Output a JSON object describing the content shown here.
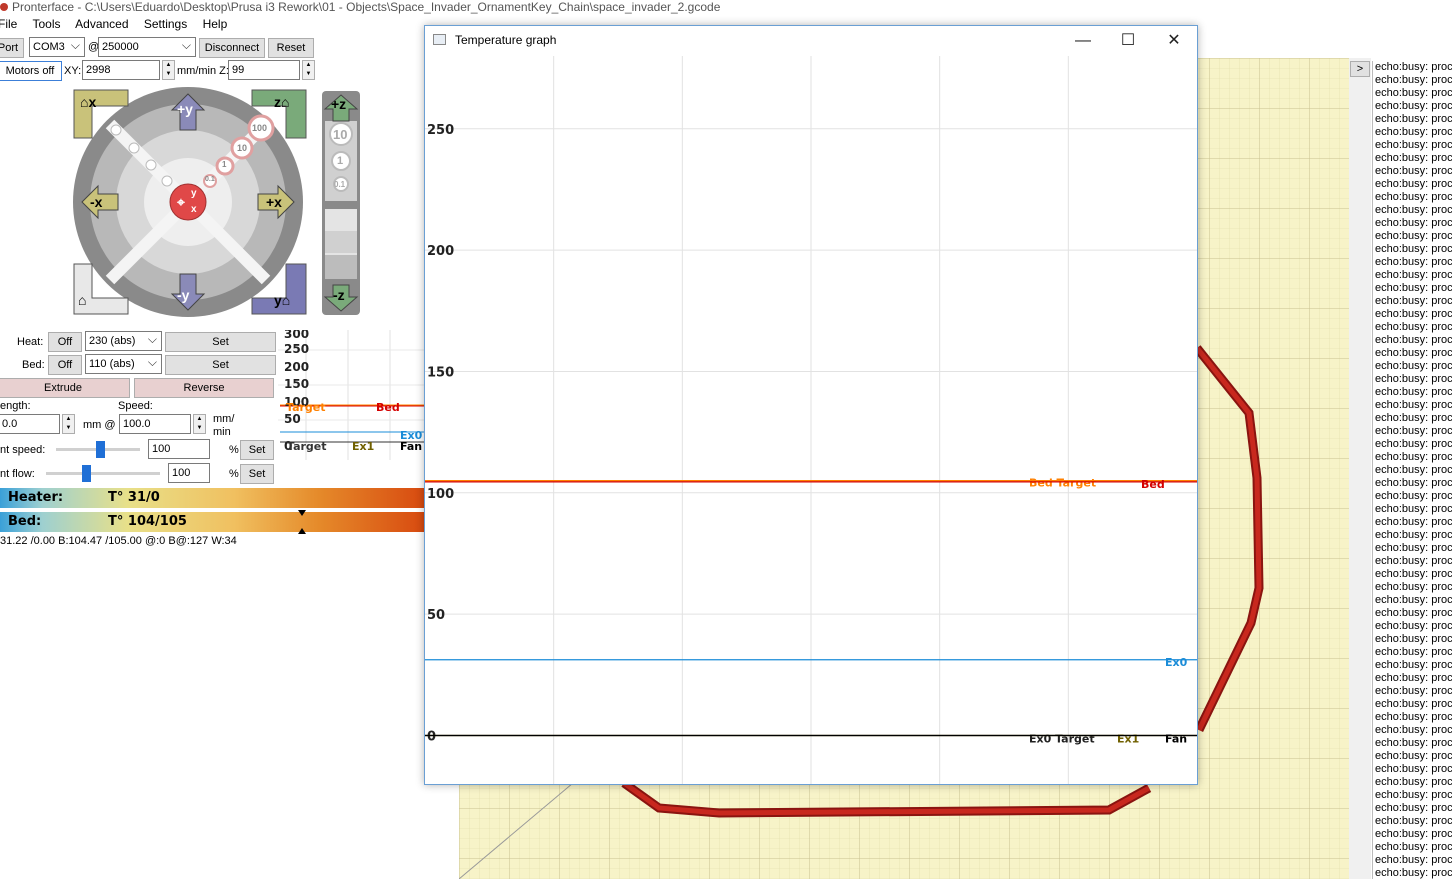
{
  "window": {
    "title": "Pronterface - C:\\Users\\Eduardo\\Desktop\\Prusa i3 Rework\\01 - Objects\\Space_Invader_OrnamentKey_Chain\\space_invader_2.gcode"
  },
  "menu": {
    "file": "File",
    "tools": "Tools",
    "advanced": "Advanced",
    "settings": "Settings",
    "help": "Help"
  },
  "toolbar": {
    "port_label": "Port",
    "port_value": "COM3",
    "at": "@",
    "baud_value": "250000",
    "disconnect": "Disconnect",
    "reset": "Reset",
    "motors_off": "Motors off",
    "xy_label": "XY:",
    "xy_value": "2998",
    "mm_min_z": "mm/min Z:",
    "z_value": "99"
  },
  "jog": {
    "home_x": "x",
    "home_z": "z",
    "home_y": "y",
    "plus_y": "+y",
    "minus_y": "-y",
    "plus_x": "+x",
    "minus_x": "-x",
    "plus_z": "+z",
    "minus_z": "-z",
    "step_100": "100",
    "step_10": "10",
    "step_1": "1",
    "step_01": "0.1",
    "z_step_10": "10",
    "z_step_1": "1",
    "z_step_01": "0.1",
    "center_y": "y",
    "center_x": "x"
  },
  "controls": {
    "heat_label": "Heat:",
    "heat_off": "Off",
    "heat_value": "230 (abs)",
    "heat_set": "Set",
    "bed_label": "Bed:",
    "bed_off": "Off",
    "bed_value": "110 (abs)",
    "bed_set": "Set",
    "extrude": "Extrude",
    "reverse": "Reverse",
    "length_label": "ength:",
    "length_value": "0.0",
    "mm_at": "mm @",
    "speed_label": "Speed:",
    "speed_value": "100.0",
    "mm_min_1": "mm/",
    "mm_min_2": "min",
    "print_speed_label": "nt speed:",
    "print_speed_value": "100",
    "print_speed_pct": "%",
    "print_speed_set": "Set",
    "print_flow_label": "nt flow:",
    "print_flow_value": "100",
    "print_flow_pct": "%",
    "print_flow_set": "Set",
    "print_speed_level": 0.52,
    "print_flow_level": 0.35
  },
  "heaters": {
    "heater_name": "Heater:",
    "heater_value": "T° 31/0",
    "bed_name": "Bed:",
    "bed_value": "T° 104/105",
    "bed_target_level": 0.71,
    "status": "31.22 /0.00 B:104.47 /105.00 @:0 B@:127 W:34"
  },
  "mini_graph": {
    "ticks": [
      "300",
      "250",
      "200",
      "150",
      "100",
      "50",
      "0"
    ],
    "labels": {
      "target": "Target",
      "bed": "Bed",
      "ex0": "Ex0",
      "ex0_target": "Target",
      "ex1": "Ex1",
      "fan": "Fan"
    }
  },
  "graph_window": {
    "title": "Temperature graph",
    "minimize": "—",
    "maximize": "☐",
    "close": "✕"
  },
  "chart_data": {
    "type": "line",
    "title": "",
    "xlabel": "",
    "ylabel": "",
    "ylim": [
      -20,
      280
    ],
    "yticks": [
      0,
      50,
      100,
      150,
      200,
      250
    ],
    "grid": true,
    "legend": "inline labels at right end of each line",
    "series": [
      {
        "name": "Bed Target",
        "color": "#ff8000",
        "values": [
          105,
          105
        ]
      },
      {
        "name": "Bed",
        "color": "#d40000",
        "values": [
          104.5,
          104.5
        ]
      },
      {
        "name": "Ex0",
        "color": "#1a8cd8",
        "values": [
          31.2,
          31.2
        ]
      },
      {
        "name": "Ex0 Target",
        "color": "#202020",
        "values": [
          0,
          0
        ]
      },
      {
        "name": "Ex1",
        "color": "#706000",
        "values": [
          0,
          0
        ]
      },
      {
        "name": "Fan",
        "color": "#000000",
        "values": [
          0,
          0
        ]
      }
    ]
  },
  "console": {
    "toggle": ">",
    "line_text": "echo:busy: proc",
    "line_count": 63
  },
  "colors": {
    "plate": "#f7f3c8",
    "plate_grid": "#d8d3a0",
    "toolpath": "#c0201c"
  }
}
